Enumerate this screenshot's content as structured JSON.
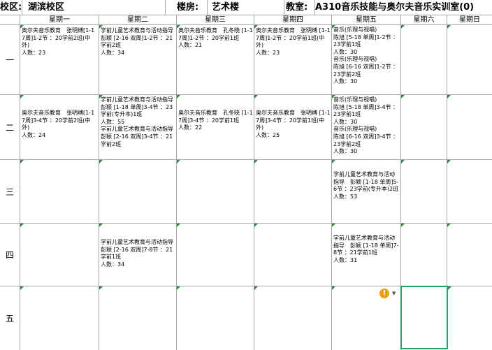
{
  "header": {
    "campus_label": "校区:",
    "campus_value": "湖滨校区",
    "building_label": "楼房:",
    "building_value": "艺术楼",
    "room_label": "教室:",
    "room_value": "A310音乐技能与奥尔夫音乐实训室(0)"
  },
  "days": [
    "星期一",
    "星期二",
    "星期三",
    "星期四",
    "星期五",
    "星期六",
    "星期日"
  ],
  "periods": [
    "一",
    "二",
    "三",
    "四",
    "五"
  ],
  "schedule": {
    "r1": {
      "mon": "奥尔夫音乐教育　张明缚[1-17周]1-2节 ：20学前2班(中外)\n人数：23",
      "tue": "学前儿童艺术教育与活动指导　彭颖 [2-16 双周]1-2节 ：21学前2班\n人数：34",
      "wed": "奥尔夫音乐教育　孔冬晓 [1-17周]1-2节 ：20学前1班\n人数：21",
      "thu": "奥尔夫音乐教育　张明缚 [1-17周]1-2节 ：20学前1班(中外)\n人数：23",
      "fri": "音乐(乐理与视唱)\n陈旭 [5-18 单周]1-2节 ：23学前1班\n人数：30\n音乐(乐理与视唱)\n陈旭 [6-16 双周]1-2节 ：23学前2班\n人数：30"
    },
    "r2": {
      "mon": "奥尔夫音乐教育　张明缚[1-17周]3-4节 ：20学前2班(中外)\n人数：24",
      "tue": "学前儿童艺术教育与活动指导　彭颖 [1-18 单周]3-4节 ：23学前(专升本)1班\n人数：55\n学前儿童艺术教育与活动指导　彭颖 [2-16 双周]3-4节 ：21学前2班",
      "wed": "奥尔夫音乐教育　孔冬晓 [1-17周]3-4节 ：20学前1班\n人数：22",
      "thu": "奥尔夫音乐教育　张明缚 [1-17周]3-4节 ：20学前1班(中外)\n人数：25",
      "fri": "音乐(乐理与视唱)\n陈旭 [5-18 单周]3-4节 ：23学前1班\n人数：30\n音乐(乐理与视唱)\n陈旭 [6-16 双周]3-4节 ：23学前2班\n人数：30"
    },
    "r3": {
      "fri": "学前儿童艺术教育与活动指导　彭颖 [1-18 单周]5-6节 ：23学前(专升本)2班\n人数：53"
    },
    "r4": {
      "tue": "学前儿童艺术教育与活动指导　彭颖 [2-16 双周]7-8节 ：21学前1班\n人数：34",
      "fri": "学前儿童艺术教育与活动指导　彭颖 [1-18 单周]7-8节 ：21学前1班\n人数：31"
    }
  },
  "icons": {
    "warning": "!",
    "dropdown": "▼"
  },
  "colors": {
    "selection": "#21a366",
    "warning": "#e8a10f",
    "marker": "#2d8a3e"
  }
}
